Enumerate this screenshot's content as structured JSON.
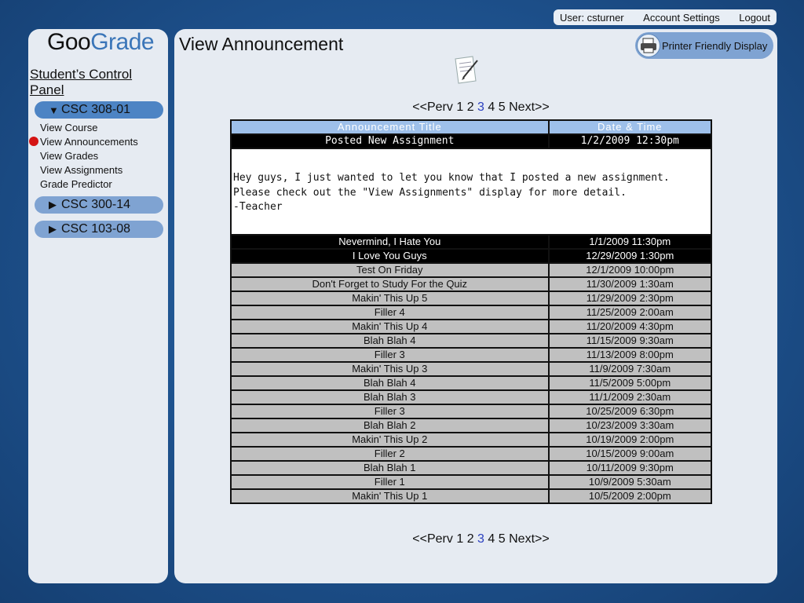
{
  "topbar": {
    "user": "User: csturner",
    "account": "Account Settings",
    "logout": "Logout"
  },
  "sidebar": {
    "logo_a": "Goo",
    "logo_b": "Grade",
    "logo_c": "G",
    "panel_title": "Student’s Control Panel",
    "courses": [
      {
        "label": "CSC 308-01",
        "arrow": "▼",
        "active": true
      },
      {
        "label": "CSC 300-14",
        "arrow": "▶",
        "active": false
      },
      {
        "label": "CSC 103-08",
        "arrow": "▶",
        "active": false
      }
    ],
    "links": [
      "View Course",
      "View Announcements",
      "View Grades",
      "View Assignments",
      "Grade Predictor"
    ]
  },
  "main": {
    "title": "View Announcement",
    "print_label": "Printer Friendly Display",
    "pager": {
      "prev": "<<Perv",
      "pages": [
        "1",
        "2",
        "3",
        "4",
        "5"
      ],
      "current": "3",
      "next": "Next>>"
    },
    "table": {
      "headers": [
        "Announcement Title",
        "Date & Time"
      ],
      "selected": {
        "title": "Posted New Assignment",
        "date": "1/2/2009   12:30pm",
        "body": "Hey guys, I just wanted to let you know that I posted a new assignment. Please check out the \"View Assignments\" display for more detail.\n-Teacher"
      },
      "rows": [
        {
          "title": "Nevermind, I Hate You",
          "date": "1/1/2009   11:30pm",
          "dark": true
        },
        {
          "title": "I Love You Guys",
          "date": "12/29/2009   1:30pm",
          "dark": true
        },
        {
          "title": "Test On Friday",
          "date": "12/1/2009   10:00pm",
          "dark": false
        },
        {
          "title": "Don't Forget to Study For the Quiz",
          "date": "11/30/2009   1:30am",
          "dark": false
        },
        {
          "title": "Makin' This Up 5",
          "date": "11/29/2009   2:30pm",
          "dark": false
        },
        {
          "title": "Filler 4",
          "date": "11/25/2009   2:00am",
          "dark": false
        },
        {
          "title": "Makin' This Up 4",
          "date": "11/20/2009   4:30pm",
          "dark": false
        },
        {
          "title": "Blah Blah 4",
          "date": "11/15/2009   9:30am",
          "dark": false
        },
        {
          "title": "Filler 3",
          "date": "11/13/2009   8:00pm",
          "dark": false
        },
        {
          "title": "Makin' This Up 3",
          "date": "11/9/2009   7:30am",
          "dark": false
        },
        {
          "title": "Blah Blah 4",
          "date": "11/5/2009   5:00pm",
          "dark": false
        },
        {
          "title": "Blah Blah 3",
          "date": "11/1/2009   2:30am",
          "dark": false
        },
        {
          "title": "Filler 3",
          "date": "10/25/2009   6:30pm",
          "dark": false
        },
        {
          "title": "Blah Blah 2",
          "date": "10/23/2009   3:30am",
          "dark": false
        },
        {
          "title": "Makin' This Up 2",
          "date": "10/19/2009   2:00pm",
          "dark": false
        },
        {
          "title": "Filler 2",
          "date": "10/15/2009   9:00am",
          "dark": false
        },
        {
          "title": "Blah Blah 1",
          "date": "10/11/2009   9:30pm",
          "dark": false
        },
        {
          "title": "Filler 1",
          "date": "10/9/2009   5:30am",
          "dark": false
        },
        {
          "title": "Makin' This Up 1",
          "date": "10/5/2009   2:00pm",
          "dark": false
        }
      ]
    }
  }
}
